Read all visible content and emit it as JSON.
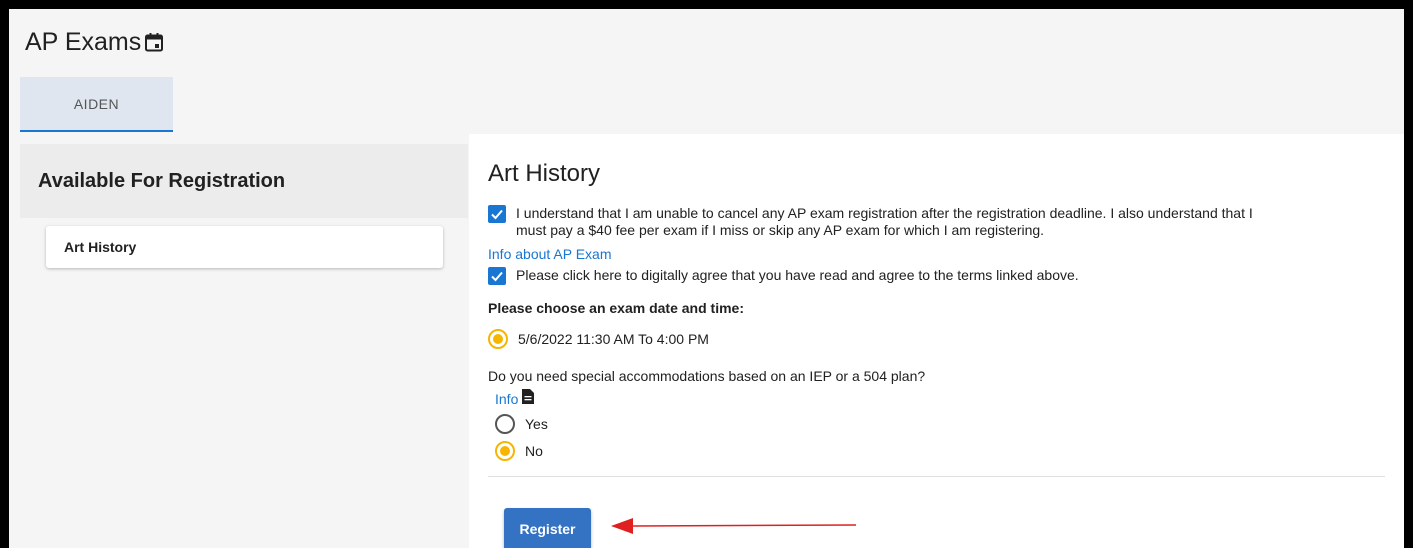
{
  "app": {
    "title": "AP Exams",
    "title_icon": "calendar-icon"
  },
  "tabs": [
    {
      "label": "AIDEN"
    }
  ],
  "sidebar": {
    "header": "Available For Registration",
    "items": [
      {
        "label": "Art History"
      }
    ]
  },
  "main": {
    "course_title": "Art History",
    "agreement_line1": "I understand that I am unable to cancel any AP exam registration after the registration deadline.  I also understand that I",
    "agreement_line2": "must pay a $40 fee per exam if I miss or skip any AP exam for which I am registering.",
    "info_ap_link": "Info about AP Exam",
    "terms_checkbox_label": "Please click here to digitally agree that you have read and agree to the terms linked above.",
    "date_prompt": "Please choose an exam date and time:",
    "date_option": "5/6/2022 11:30 AM To 4:00 PM",
    "accommodation_question": "Do you need special accommodations based on an IEP or a 504 plan?",
    "info_link": "Info",
    "info_icon": "document-icon",
    "options": [
      {
        "label": "Yes",
        "selected": false
      },
      {
        "label": "No",
        "selected": true
      }
    ],
    "register_button": "Register"
  },
  "colors": {
    "accent": "#1976d2",
    "radio_selected": "#f6b500",
    "register_button": "#3472c4",
    "annotation_arrow": "#e02020"
  }
}
